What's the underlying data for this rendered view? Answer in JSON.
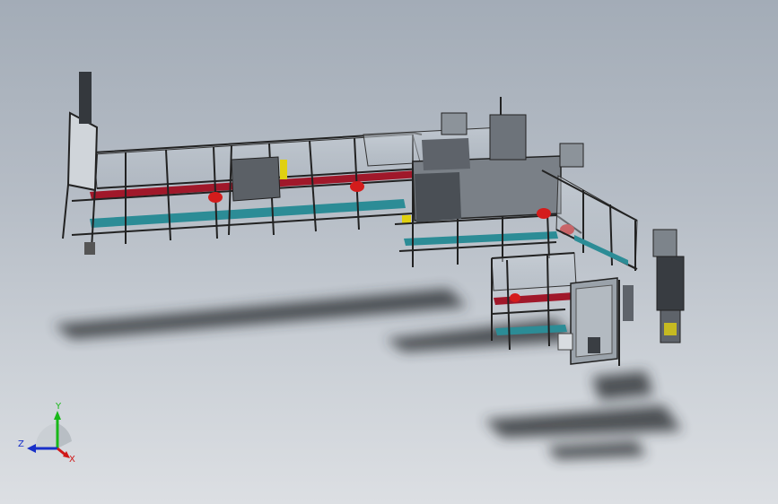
{
  "viewport": {
    "background_top": "#a3acb7",
    "background_bottom": "#dcdfe3"
  },
  "triad": {
    "x_label": "X",
    "y_label": "Y",
    "z_label": "Z",
    "x_color": "#d01818",
    "y_color": "#18b818",
    "z_color": "#1830c8"
  },
  "model": {
    "frame_color": "#2c2f33",
    "conveyor_red": "#a0182a",
    "conveyor_teal": "#2c8c96",
    "motor_red": "#d41c1c",
    "glass": "#c4ccd4",
    "accent_yellow": "#e0d010",
    "cabinet": "#9aa2aa"
  }
}
